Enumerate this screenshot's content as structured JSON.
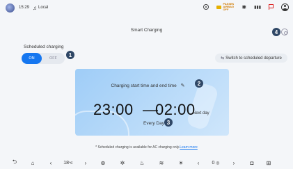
{
  "status_bar": {
    "time": "15:29",
    "media_source": "Local",
    "badge_text": "PASSENGER AIRBAG OFF"
  },
  "page": {
    "title": "Smart Charging"
  },
  "scheduled_charging": {
    "label": "Scheduled charging",
    "on_label": "ON",
    "off_label": "OFF"
  },
  "switch_button": {
    "label": "Switch to scheduled departure"
  },
  "schedule_card": {
    "label": "Charging start time and end time",
    "start_time": "23:00",
    "separator": "—",
    "end_time": "02:00",
    "end_note": "Next day",
    "repeat": "Every Day"
  },
  "footnote": {
    "text": "* Scheduled charging is available for AC charging only.",
    "link": "Learn more"
  },
  "callouts": [
    "1",
    "2",
    "3",
    "4"
  ],
  "dock": {
    "left_temp": "18",
    "left_temp_unit": "℃",
    "right_value": "0"
  },
  "colors": {
    "accent": "#1677f0",
    "callout": "#2f4766",
    "card_gradient_start": "#9fcdf7"
  }
}
